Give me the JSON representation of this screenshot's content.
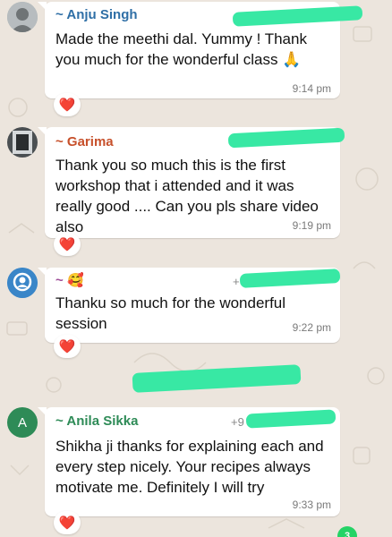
{
  "messages": [
    {
      "sender": "~ Anju Singh",
      "sender_color": "#2f6fa6",
      "text": "Made the meethi dal. Yummy ! Thank you much for the wonderful class",
      "emoji": "🙏",
      "time": "9:14 pm",
      "reaction": "❤️"
    },
    {
      "sender": "~ Garima",
      "sender_color": "#c7502b",
      "text": "Thank you so much this is the first workshop that i attended and it was really good .... Can you pls share video also",
      "time": "9:19 pm",
      "reaction": "❤️"
    },
    {
      "sender": "~",
      "sender_emoji": "🥰",
      "sender_color": "#a0509a",
      "phone": "+",
      "text": "Thanku so much for the wonderful session",
      "time": "9:22 pm",
      "reaction": "❤️"
    },
    {
      "sender": "~ Anila Sikka",
      "sender_color": "#2e8b57",
      "phone": "+9",
      "avatar_letter": "A",
      "text": "Shikha ji thanks for explaining each and every step nicely. Your recipes always motivate me. Definitely I will try",
      "time": "9:33 pm",
      "reaction": "❤️"
    }
  ],
  "unread_count": "3",
  "colors": {
    "chat_background": "#ece5dd",
    "bubble": "#ffffff",
    "redaction": "#38e8a4",
    "avatar_default": "#3a86c8",
    "avatar_letter_bg": "#2e8b57"
  }
}
